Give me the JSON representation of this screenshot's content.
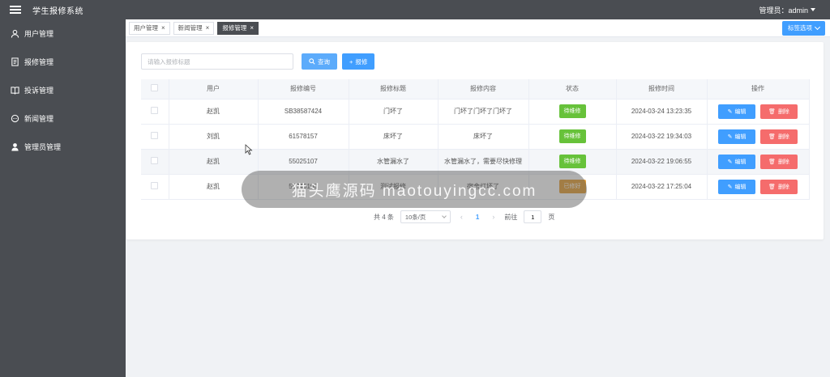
{
  "app": {
    "title": "学生报修系统",
    "admin_label": "管理员：admin"
  },
  "sidebar": {
    "items": [
      {
        "label": "用户管理",
        "icon": "user-icon"
      },
      {
        "label": "报修管理",
        "icon": "document-icon"
      },
      {
        "label": "投诉管理",
        "icon": "book-icon"
      },
      {
        "label": "新闻管理",
        "icon": "chat-icon"
      },
      {
        "label": "管理员管理",
        "icon": "admin-user-icon"
      }
    ]
  },
  "tabs": [
    {
      "label": "用户管理",
      "active": false
    },
    {
      "label": "新闻管理",
      "active": false
    },
    {
      "label": "报修管理",
      "active": true
    }
  ],
  "tab_options_label": "标签选项",
  "search": {
    "placeholder": "请输入报修标题",
    "value": ""
  },
  "toolbar": {
    "search_label": "查询",
    "add_label": "报修"
  },
  "table": {
    "headers": [
      "",
      "用户",
      "报修编号",
      "报修标题",
      "报修内容",
      "状态",
      "报修时间",
      "操作"
    ],
    "rows": [
      {
        "user": "赵凯",
        "code": "SB38587424",
        "title": "门坏了",
        "content": "门坏了门坏了门坏了",
        "status": "待维修",
        "time": "2024-03-24 13:23:35"
      },
      {
        "user": "刘凯",
        "code": "61578157",
        "title": "床坏了",
        "content": "床坏了",
        "status": "待维修",
        "time": "2024-03-22 19:34:03"
      },
      {
        "user": "赵凯",
        "code": "55025107",
        "title": "水管漏水了",
        "content": "水管漏水了，需要尽快修理",
        "status": "待维修",
        "time": "2024-03-22 19:06:55"
      },
      {
        "user": "赵凯",
        "code": "58746100",
        "title": "测试报修",
        "content": "宿舍灯坏了",
        "status": "已修好",
        "time": "2024-03-22 17:25:04"
      }
    ],
    "edit_label": "编辑",
    "delete_label": "删除"
  },
  "pagination": {
    "total_text": "共 4 条",
    "page_size": "10条/页",
    "current_page": "1",
    "goto_label": "前往",
    "goto_value": "1",
    "page_suffix": "页"
  },
  "overlay_text": "猫头鹰源码 maotouyingcc.com",
  "colors": {
    "primary": "#409eff",
    "success": "#67c23a",
    "warning": "#e6a23c",
    "danger": "#f56c6c",
    "sidebar": "#4a4d52"
  }
}
